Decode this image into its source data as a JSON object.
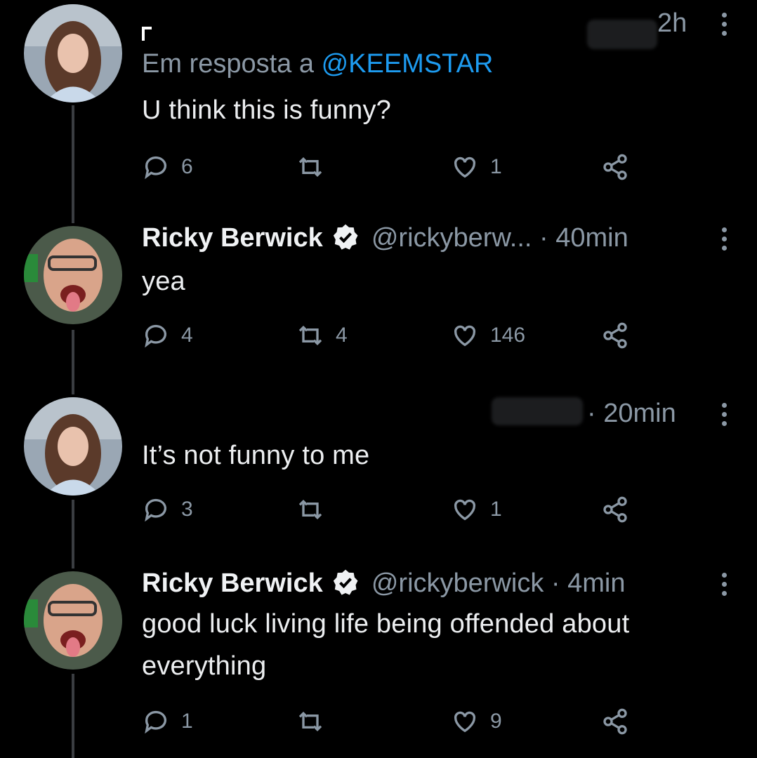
{
  "tweets": [
    {
      "reply_prefix": "Em resposta a ",
      "reply_mention": "@KEEMSTAR",
      "time": "2h",
      "text": "U think this is funny?",
      "replies": "6",
      "retweets": "",
      "likes": "1"
    },
    {
      "name": "Ricky Berwick",
      "handle": "@rickyberw...",
      "time": "· 40min",
      "text": "yea",
      "replies": "4",
      "retweets": "4",
      "likes": "146"
    },
    {
      "time": "· 20min",
      "text": "It’s not funny to me",
      "replies": "3",
      "retweets": "",
      "likes": "1"
    },
    {
      "name": "Ricky Berwick",
      "handle": "@rickyberwick",
      "time": "· 4min",
      "text_line1": "good luck living life being offended about",
      "text_line2": "everything",
      "replies": "1",
      "retweets": "",
      "likes": "9"
    }
  ],
  "colors": {
    "accent": "#1d9bf0",
    "muted": "#8b98a5",
    "background": "#000000"
  }
}
